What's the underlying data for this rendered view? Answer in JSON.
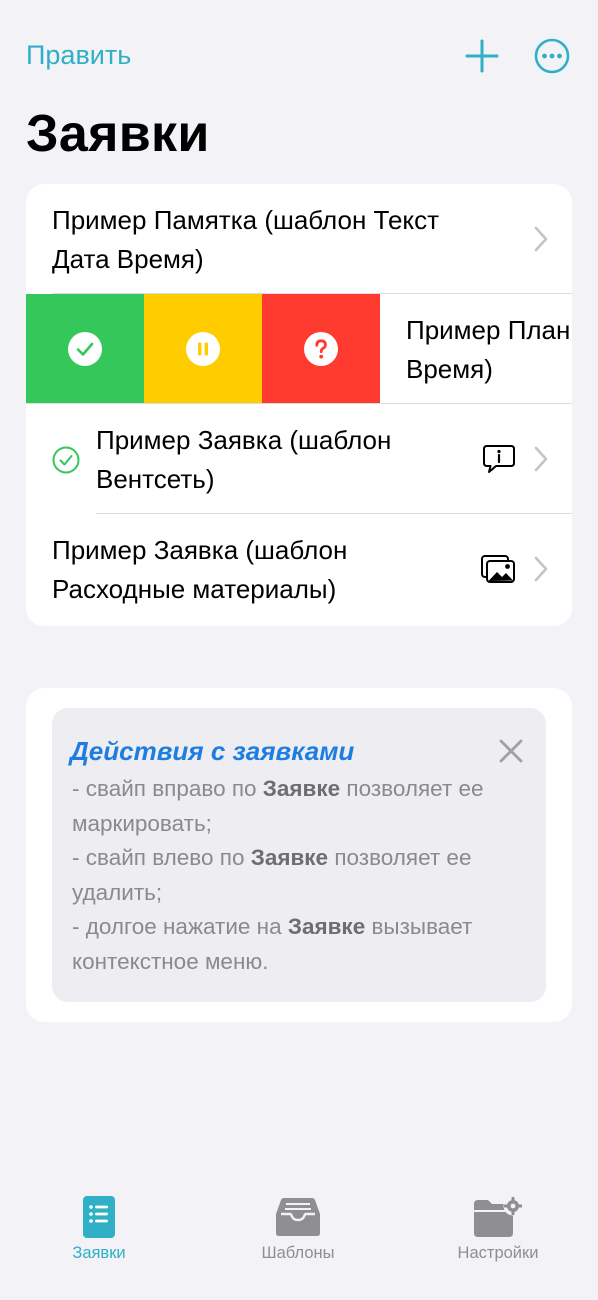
{
  "nav": {
    "edit_label": "Править"
  },
  "page": {
    "title": "Заявки"
  },
  "rows": [
    {
      "line1": "Пример Памятка (шаблон Текст",
      "line2": "Дата Время)"
    },
    {
      "line1": "Пример План",
      "line2": "Время)"
    },
    {
      "line1": "Пример Заявка (шаблон",
      "line2": "Вентсеть)"
    },
    {
      "line1": "Пример Заявка (шаблон",
      "line2": "Расходные материалы)"
    }
  ],
  "swipe_actions": {
    "colors": {
      "done": "#34c759",
      "pause": "#ffcc00",
      "question": "#ff3b30"
    },
    "icons": [
      "checkmark-icon",
      "pause-icon",
      "question-icon"
    ]
  },
  "info": {
    "title": "Действия с заявками",
    "lines": [
      {
        "pre": "- свайп вправо по ",
        "bold": "Заявке",
        "post": " позволяет ее маркировать;"
      },
      {
        "pre": "- свайп влево по ",
        "bold": "Заявке",
        "post": " позволяет ее удалить;"
      },
      {
        "pre": "- долгое нажатие на ",
        "bold": "Заявке",
        "post": " вызывает контекстное меню."
      }
    ]
  },
  "tabs": [
    {
      "label": "Заявки",
      "icon": "list-icon",
      "active": true
    },
    {
      "label": "Шаблоны",
      "icon": "tray-icon",
      "active": false
    },
    {
      "label": "Настройки",
      "icon": "folder-gear-icon",
      "active": false
    }
  ],
  "colors": {
    "accent": "#30b0c7",
    "link_blue": "#1e7ee0"
  }
}
